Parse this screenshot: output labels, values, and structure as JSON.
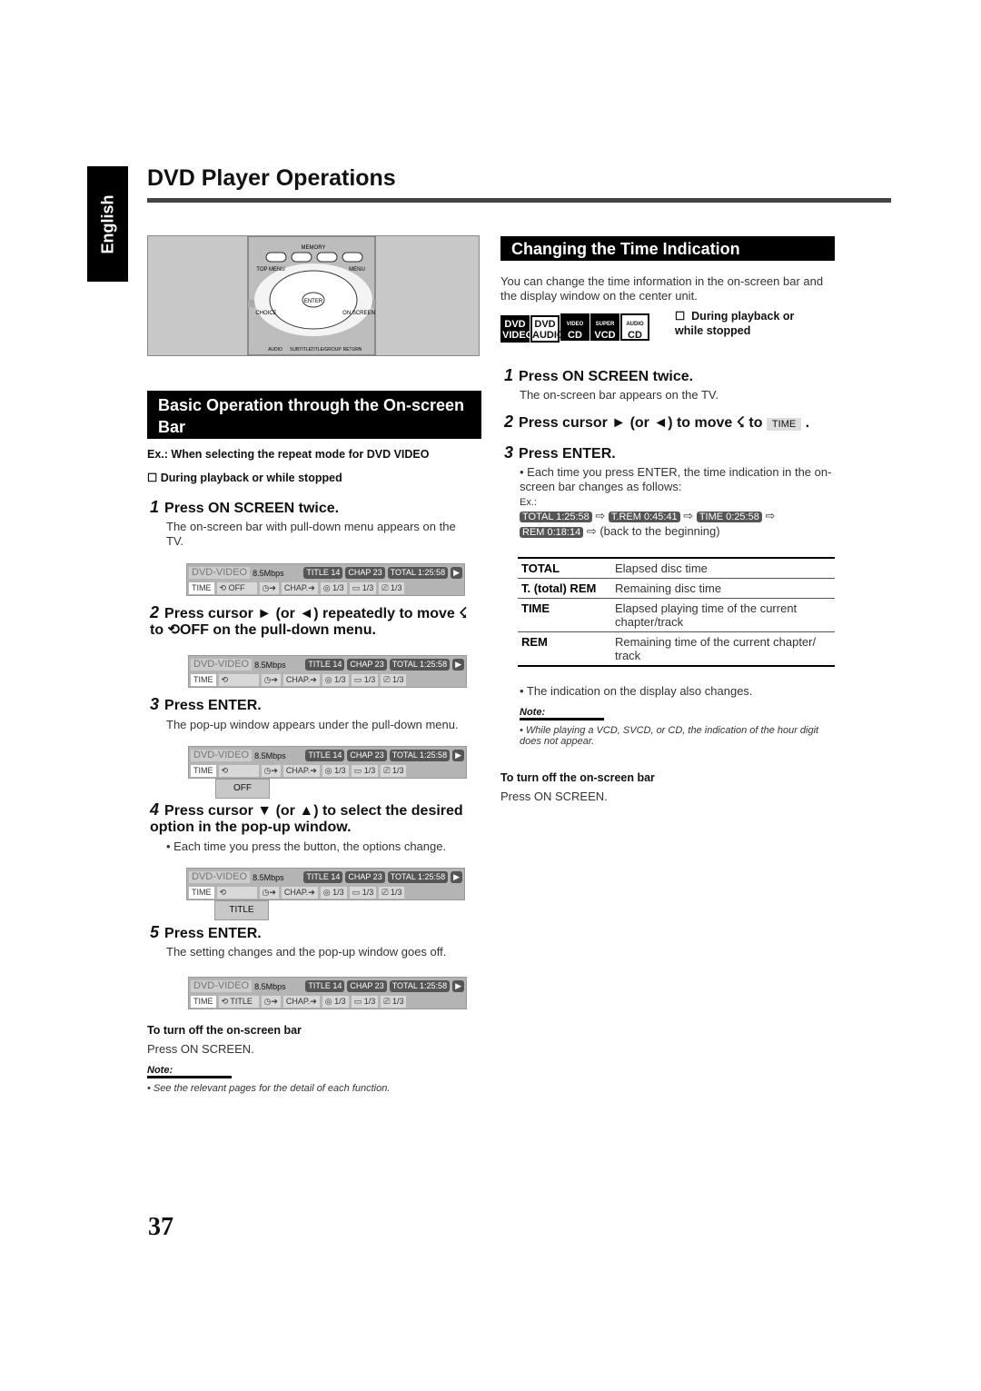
{
  "sidebar": {
    "language": "English"
  },
  "header": {
    "title": "DVD Player Operations"
  },
  "remote": {
    "labels": [
      "MEMORY",
      "TOP MENU",
      "MENU",
      "ENTER",
      "CHOICE",
      "ON SCREEN",
      "AUDIO",
      "SUBTITLE",
      "TITLE/GROUP",
      "RETURN"
    ]
  },
  "left": {
    "heading": "Basic Operation through the On-screen Bar",
    "example": "Ex.: When selecting the repeat mode for DVD VIDEO",
    "condition": "During playback or while stopped",
    "steps": [
      {
        "num": "1",
        "title": "Press ON SCREEN twice.",
        "desc": "The on-screen bar with pull-down menu appears on the TV."
      },
      {
        "num": "2",
        "title": "Press cursor ► (or ◄) repeatedly to move ☇ to ⟲OFF on the pull-down menu.",
        "desc": ""
      },
      {
        "num": "3",
        "title": "Press ENTER.",
        "desc": "The pop-up window appears under the pull-down menu."
      },
      {
        "num": "4",
        "title": "Press cursor ▼ (or ▲) to select the desired option in the pop-up window.",
        "desc": "• Each time you press the button, the options change."
      },
      {
        "num": "5",
        "title": "Press ENTER.",
        "desc": "The setting changes and the pop-up window goes off."
      }
    ],
    "osd": {
      "source": "DVD-VIDEO",
      "rate": "8.5Mbps",
      "title": "TITLE 14",
      "chap": "CHAP 23",
      "total": "TOTAL 1:25:58",
      "time": "TIME",
      "chap_arrow": "CHAP.➔",
      "audio": "1/3",
      "subtitle": "1/3",
      "angle": "1/3"
    },
    "osd_repeat": [
      "OFF",
      "",
      "",
      "",
      "TITLE"
    ],
    "popups": {
      "bar3": "OFF",
      "bar4": "TITLE"
    },
    "turn_off_heading": "To turn off the on-screen bar",
    "turn_off_text": "Press ON SCREEN.",
    "note_label": "Note:",
    "note_text": "•  See the relevant pages for the detail of each function."
  },
  "right": {
    "heading": "Changing the Time Indication",
    "intro": "You can change the time information in the on-screen bar and the display window on the center unit.",
    "discs": [
      [
        "DVD",
        "VIDEO"
      ],
      [
        "DVD",
        "AUDIO"
      ],
      [
        "VIDEO",
        "CD"
      ],
      [
        "SUPER",
        "VCD"
      ],
      [
        "AUDIO",
        "CD"
      ]
    ],
    "condition": "During playback or while stopped",
    "steps": [
      {
        "num": "1",
        "title": "Press ON SCREEN twice.",
        "desc": "The on-screen bar appears on the TV."
      },
      {
        "num": "2",
        "title": "Press cursor ► (or ◄) to move ☇ to",
        "chip": "TIME"
      },
      {
        "num": "3",
        "title": "Press ENTER.",
        "desc": "• Each time you press ENTER, the time indication in the on-screen bar changes as follows:"
      }
    ],
    "ex_label": "Ex.:",
    "sequence": [
      "TOTAL  1:25:58",
      "T.REM  0:45:41",
      "TIME  0:25:58",
      "REM  0:18:14"
    ],
    "sequence_end": "(back to the beginning)",
    "table": [
      {
        "key": "TOTAL",
        "desc": "Elapsed disc time"
      },
      {
        "key": "T. (total) REM",
        "desc": "Remaining disc time"
      },
      {
        "key": "TIME",
        "desc": "Elapsed playing time of the current chapter/track"
      },
      {
        "key": "REM",
        "desc": "Remaining time of the current chapter/ track"
      }
    ],
    "display_note": "• The indication on the display also changes.",
    "note_label": "Note:",
    "note_text": "•  While playing a VCD, SVCD, or CD, the indication of the hour digit does not appear.",
    "turn_off_heading": "To turn off the on-screen bar",
    "turn_off_text": "Press ON SCREEN."
  },
  "page_number": "37"
}
